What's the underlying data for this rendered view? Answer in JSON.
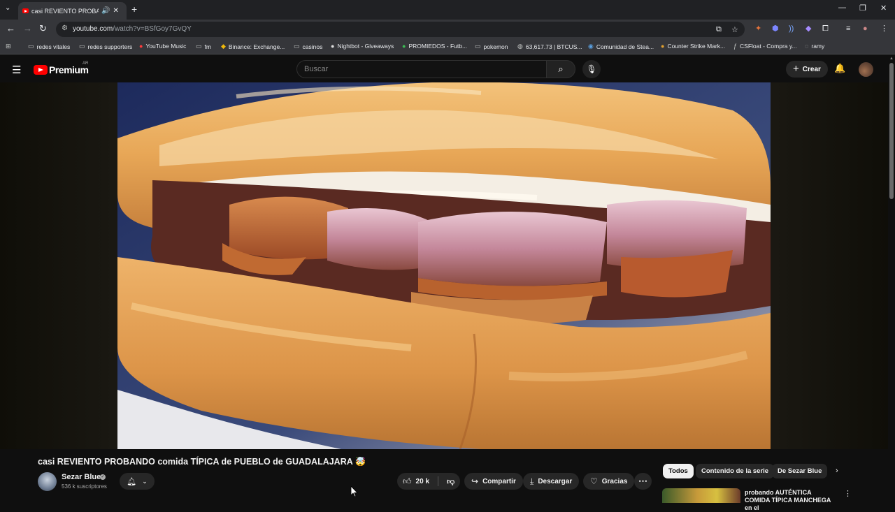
{
  "browser": {
    "tab_title": "casi REVIENTO PROBANDO comida TÍPICA de PUEBLO de GUADALAJARA",
    "url_host": "youtube.com",
    "url_path": "/watch?v=BSfGoy7GvQY",
    "bookmarks": [
      {
        "label": "redes vitales",
        "icon": "folder-icon"
      },
      {
        "label": "redes supporters",
        "icon": "folder-icon"
      },
      {
        "label": "YouTube Music",
        "icon": "youtube-music-icon"
      },
      {
        "label": "fm",
        "icon": "folder-icon"
      },
      {
        "label": "Binance: Exchange...",
        "icon": "binance-icon"
      },
      {
        "label": "casinos",
        "icon": "folder-icon"
      },
      {
        "label": "Nightbot - Giveaways",
        "icon": "nightbot-icon"
      },
      {
        "label": "PROMIEDOS - Futb...",
        "icon": "promiedos-icon"
      },
      {
        "label": "pokemon",
        "icon": "folder-icon"
      },
      {
        "label": "63,617.73 | BTCUS...",
        "icon": "tradingview-icon"
      },
      {
        "label": "Comunidad de Stea...",
        "icon": "steam-icon"
      },
      {
        "label": "Counter Strike Mark...",
        "icon": "cs-market-icon"
      },
      {
        "label": "CSFloat - Compra y...",
        "icon": "csfloat-icon"
      },
      {
        "label": "ramy",
        "icon": "globe-icon"
      }
    ]
  },
  "masthead": {
    "logo_text": "Premium",
    "country": "AR",
    "search_placeholder": "Buscar",
    "create_label": "Crear"
  },
  "video": {
    "title": "casi REVIENTO PROBANDO comida TÍPICA de PUEBLO de GUADALAJARA",
    "title_emoji": "🤯",
    "channel_name": "Sezar Blue",
    "subscribers": "536 k suscriptores",
    "likes": "20 k",
    "share_label": "Compartir",
    "download_label": "Descargar",
    "thanks_label": "Gracias"
  },
  "sidebar": {
    "chips": [
      "Todos",
      "Contenido de la serie",
      "De Sezar Blue"
    ],
    "active_chip": "Todos",
    "recommendation": {
      "title": "probando AUTÉNTICA COMIDA TÍPICA MANCHEGA en el"
    }
  },
  "colors": {
    "youtube_red": "#ff0000",
    "background": "#0f0f0f",
    "pill_bg": "#272727"
  }
}
